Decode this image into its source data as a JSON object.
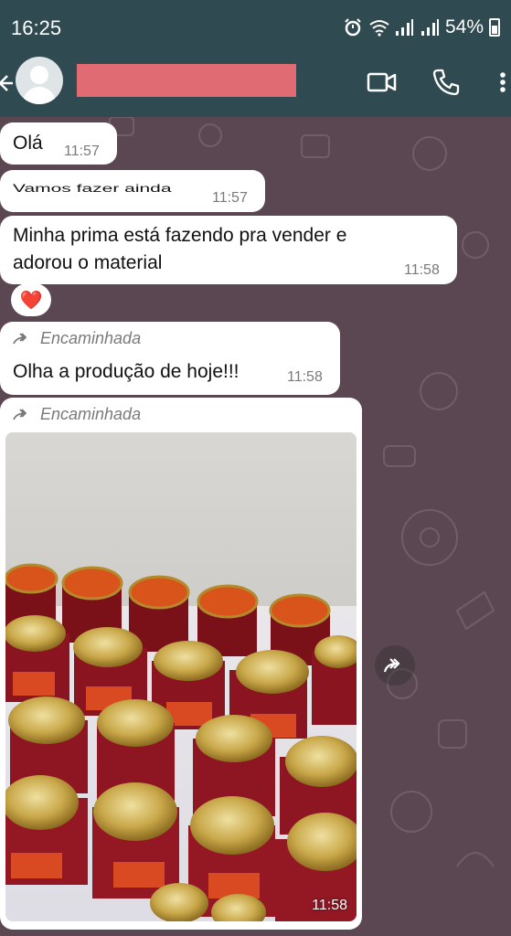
{
  "status_bar": {
    "time": "16:25",
    "battery": "54%",
    "icons": [
      "alarm-icon",
      "wifi-icon",
      "signal-icon",
      "signal-icon",
      "battery-icon"
    ]
  },
  "header": {
    "contact_name_redacted": true,
    "actions": [
      "video-call-icon",
      "phone-icon",
      "more-icon"
    ]
  },
  "messages": [
    {
      "text": "Olá",
      "time": "11:57"
    },
    {
      "text": "Vamos fazer ainda",
      "time": "11:57"
    },
    {
      "text": "Minha prima está fazendo pra vender e adorou o material",
      "time": "11:58",
      "reaction": "❤️"
    },
    {
      "forwarded_label": "Encaminhada",
      "text": "Olha a produção  de hoje!!!",
      "time": "11:58"
    },
    {
      "forwarded_label": "Encaminhada",
      "image": "jam-jars-photo",
      "time": "11:58"
    }
  ],
  "colors": {
    "header_bg": "#2f4a51",
    "chat_bg": "#5b4752",
    "bubble_bg": "#ffffff",
    "time_text": "#7a7a7a"
  }
}
